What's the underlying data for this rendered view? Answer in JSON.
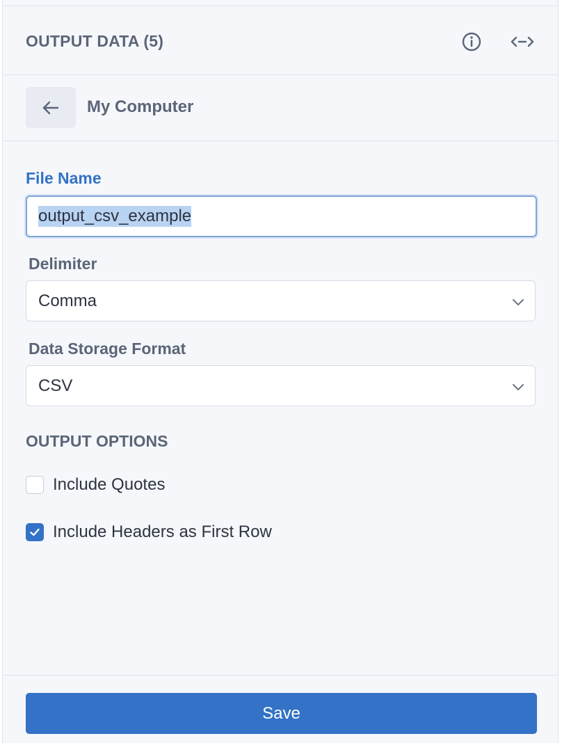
{
  "header": {
    "title": "OUTPUT DATA (5)",
    "icons": [
      "info-icon",
      "expand-horizontal-icon"
    ]
  },
  "subheader": {
    "back_icon": "arrow-left-icon",
    "title": "My Computer"
  },
  "form": {
    "file_name": {
      "label": "File Name",
      "value": "output_csv_example"
    },
    "delimiter": {
      "label": "Delimiter",
      "selected": "Comma"
    },
    "storage_format": {
      "label": "Data Storage Format",
      "selected": "CSV"
    }
  },
  "output_options": {
    "title": "OUTPUT OPTIONS",
    "items": [
      {
        "label": "Include Quotes",
        "checked": false
      },
      {
        "label": "Include Headers as First Row",
        "checked": true
      }
    ]
  },
  "footer": {
    "save_label": "Save"
  },
  "colors": {
    "accent": "#3372c6",
    "panel_bg": "#f5f7fb",
    "label_text": "#5b6577",
    "body_text": "#2d3340"
  }
}
